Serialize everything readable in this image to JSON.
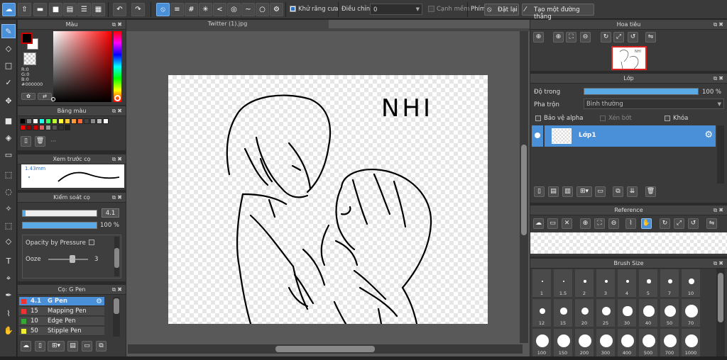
{
  "toolbar": {
    "antialias_label": "Khử răng cưa",
    "adjust_label": "Điều chỉnh",
    "adjust_value": "0",
    "smooth_label": "Cạnh mềm",
    "keys_label": "Phím",
    "reset_label": "Đặt lại",
    "ruler_label": "Tạo một đường thẳng"
  },
  "color_panel": {
    "title": "Màu",
    "rgb_r": "R:0",
    "rgb_g": "G:0",
    "rgb_b": "B:0",
    "hex": "#000000",
    "fg_color": "#000000",
    "accent": "#cc0000"
  },
  "palette_panel": {
    "title": "Bảng màu",
    "colors": [
      "#000000",
      "#7f7f7f",
      "#ffffff",
      "#22ffee",
      "#33ff66",
      "#bbff33",
      "#ffff33",
      "#ffcc33",
      "#ff9933",
      "#ff6633",
      "#444444",
      "#888888",
      "#bbbbbb",
      "#ffffff",
      "#ff0000",
      "#8b0000",
      "#cc0000",
      "#e06060",
      "#999999",
      "#555555",
      "#333333",
      "#222222"
    ]
  },
  "brush_preview": {
    "title": "Xem trước cọ",
    "size": "1.43mm"
  },
  "brush_control": {
    "title": "Kiểm soát cọ",
    "size_value": "4.1",
    "opacity_value": "100 %",
    "opacity_fraction": 1.0,
    "size_fraction": 0.04,
    "pressure_label": "Opacity by Pressure",
    "ooze_label": "Ooze",
    "ooze_value": "3"
  },
  "brush_list": {
    "title": "Cọ: G Pen",
    "items": [
      {
        "size": "4.1",
        "name": "G Pen",
        "color": "#ee3333"
      },
      {
        "size": "15",
        "name": "Mapping Pen",
        "color": "#ee3333"
      },
      {
        "size": "10",
        "name": "Edge Pen",
        "color": "#33aa33"
      },
      {
        "size": "50",
        "name": "Stipple Pen",
        "color": "#eeee33"
      }
    ]
  },
  "document": {
    "tab": "Twitter (1).jpg",
    "canvas_text": "NHI"
  },
  "navigator": {
    "title": "Hoa tiêu"
  },
  "layer_panel": {
    "title": "Lớp",
    "opacity_label": "Độ trong",
    "opacity_value": "100 %",
    "opacity_fraction": 1.0,
    "blend_label": "Pha trộn",
    "blend_value": "Bình thường",
    "protect_alpha": "Bảo vệ alpha",
    "clipping": "Xén bớt",
    "lock": "Khóa",
    "layer_name": "Lớp1"
  },
  "reference_panel": {
    "title": "Reference"
  },
  "brush_size_panel": {
    "title": "Brush Size",
    "sizes": [
      "1",
      "1.5",
      "2",
      "3",
      "4",
      "5",
      "7",
      "10",
      "12",
      "15",
      "20",
      "25",
      "30",
      "40",
      "50",
      "70",
      "100",
      "150",
      "200",
      "300",
      "400",
      "500",
      "700",
      "1000"
    ]
  }
}
